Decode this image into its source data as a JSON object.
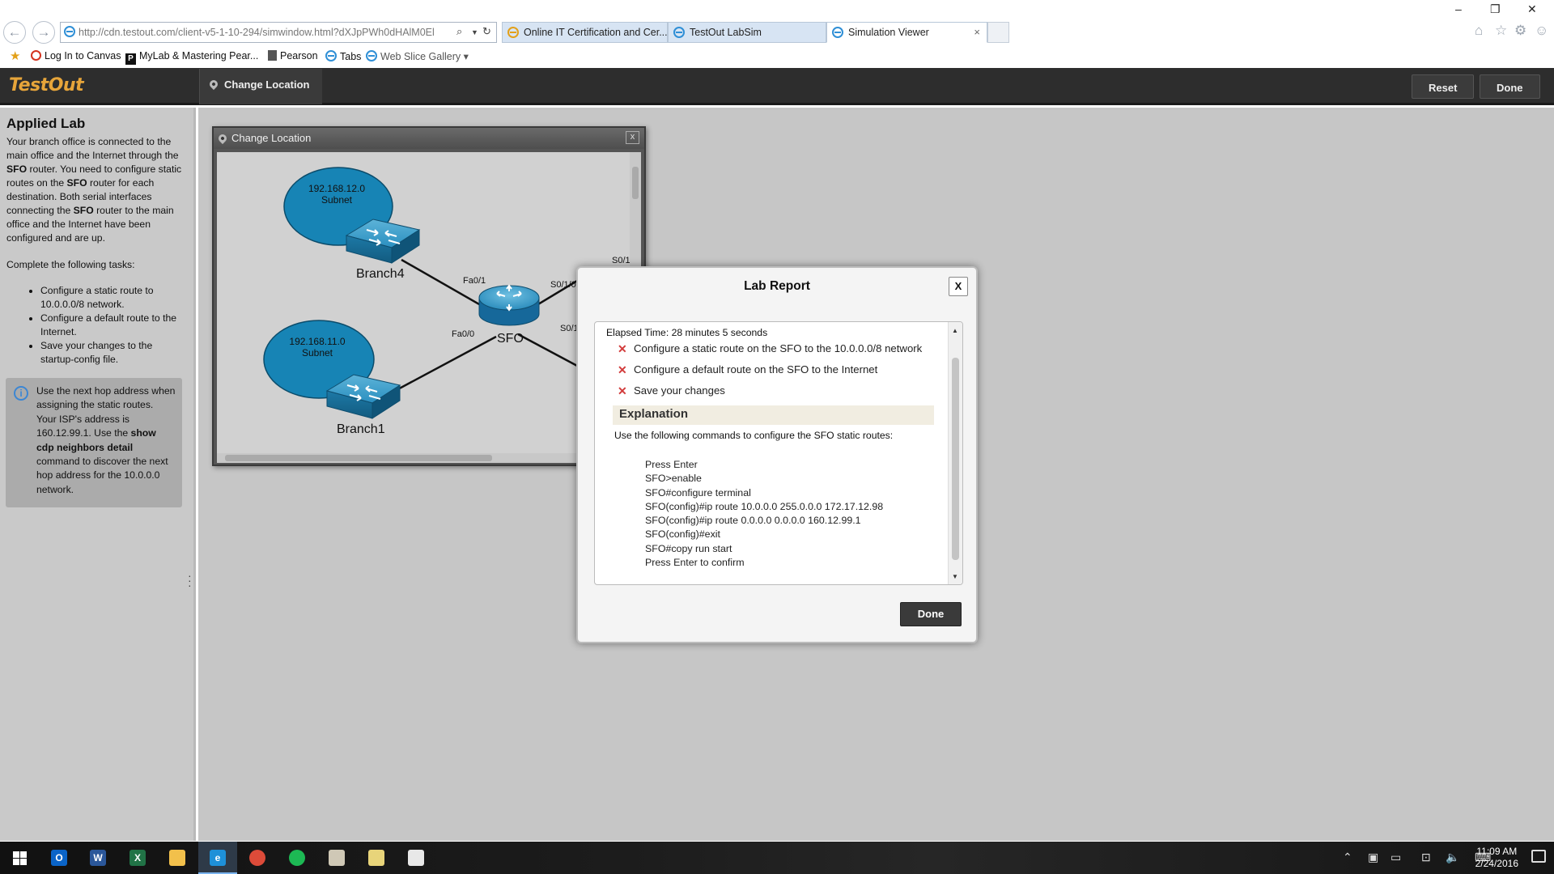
{
  "browser": {
    "url_host": "http://cdn.testout.com",
    "url_path": "/client-v5-1-10-294/simwindow.html?dXJpPWh0dHAlM0ElMkYlM",
    "tabs": [
      {
        "label": "Online IT Certification and Cer..."
      },
      {
        "label": "TestOut LabSim"
      },
      {
        "label": "Simulation Viewer",
        "close": "×"
      }
    ],
    "window_controls": {
      "minimize": "–",
      "restore": "❐",
      "close": "✕"
    },
    "favorites": [
      {
        "label": "Log In to Canvas"
      },
      {
        "label": "MyLab & Mastering  Pear..."
      },
      {
        "label": "Pearson"
      },
      {
        "label": "Tabs"
      },
      {
        "label": "Web Slice Gallery ▾"
      }
    ]
  },
  "app": {
    "logo": "TestOut",
    "change_location": "Change Location",
    "reset": "Reset",
    "done": "Done"
  },
  "lab": {
    "title": "Applied Lab",
    "description_parts": [
      "Your branch office is connected to the main office and the Internet through the ",
      "SFO",
      " router. You need to configure static routes on the ",
      "SFO",
      " router for each destination. Both serial interfaces connecting the ",
      "SFO",
      " router to the main office and the Internet have been configured and are up."
    ],
    "tasks_intro": "Complete the following tasks:",
    "tasks": [
      "Configure a static route to 10.0.0.0/8 network.",
      "Configure a default route to the Internet.",
      "Save your changes to the startup-config file."
    ],
    "tip_parts": [
      "Use the next hop address when assigning the static routes. Your ISP's address is 160.12.99.1. Use the ",
      "show cdp neighbors detail",
      " command to discover the next hop address for the 10.0.0.0 network."
    ]
  },
  "location_window": {
    "title": "Change Location",
    "close": "x",
    "network": {
      "subnet_top": {
        "ip": "192.168.12.0",
        "label": "Subnet"
      },
      "subnet_bottom": {
        "ip": "192.168.11.0",
        "label": "Subnet"
      },
      "switch_top": "Branch4",
      "switch_bottom": "Branch1",
      "router": "SFO",
      "ports": {
        "fa01": "Fa0/1",
        "fa00": "Fa0/0",
        "s010": "S0/1/0",
        "s011": "S0/1/",
        "s01x": "S0/1/"
      }
    }
  },
  "report": {
    "title": "Lab Report",
    "close": "X",
    "elapsed": "Elapsed Time: 28 minutes 5 seconds",
    "results": [
      {
        "mark": "✕",
        "text": "Configure a static route on the SFO to the 10.0.0.0/8 network"
      },
      {
        "mark": "✕",
        "text": "Configure a default route on the SFO to the Internet"
      },
      {
        "mark": "✕",
        "text": "Save your changes"
      }
    ],
    "explanation_heading": "Explanation",
    "explanation_intro": "Use the following commands to configure the SFO static routes:",
    "commands": [
      "Press Enter",
      "SFO>enable",
      "SFO#configure terminal",
      "SFO(config)#ip route 10.0.0.0 255.0.0.0 172.17.12.98",
      "SFO(config)#ip route 0.0.0.0 0.0.0.0 160.12.99.1",
      "SFO(config)#exit",
      "SFO#copy run start",
      "Press Enter to confirm"
    ],
    "done": "Done"
  },
  "taskbar": {
    "apps": [
      {
        "name": "outlook",
        "glyph": "O",
        "color": "#0a64c8"
      },
      {
        "name": "word",
        "glyph": "W",
        "color": "#2b579a"
      },
      {
        "name": "excel",
        "glyph": "X",
        "color": "#217346"
      },
      {
        "name": "file-explorer",
        "glyph": "",
        "color": "#f2c04b"
      },
      {
        "name": "internet-explorer",
        "glyph": "e",
        "color": "#1e90d8"
      },
      {
        "name": "chrome",
        "glyph": "",
        "color": "#dd4b39"
      },
      {
        "name": "spotify",
        "glyph": "",
        "color": "#1db954"
      },
      {
        "name": "app-7",
        "glyph": "",
        "color": "#cfc8b6"
      },
      {
        "name": "app-8",
        "glyph": "",
        "color": "#e8d47a"
      },
      {
        "name": "calculator",
        "glyph": "",
        "color": "#e8e8e8"
      }
    ],
    "time": "11:09 AM",
    "date": "2/24/2016"
  },
  "colors": {
    "accent_orange": "#e7a53a",
    "app_header": "#2d2d2d",
    "fail_red": "#d23b3b",
    "switch_blue": "#1f7fb0",
    "subnet_blue": "#1784b5"
  }
}
